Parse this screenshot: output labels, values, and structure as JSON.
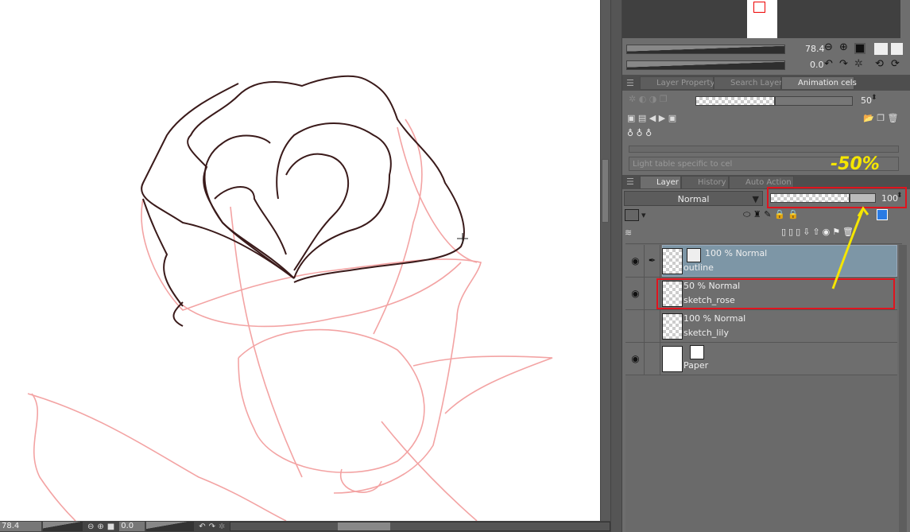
{
  "navigator": {
    "zoom": "78.4",
    "rotation": "0.0"
  },
  "tabs_top": [
    {
      "label": "Layer Property"
    },
    {
      "label": "Search Layer"
    },
    {
      "label": "Animation cels"
    }
  ],
  "animation_cels": {
    "opacity": "50",
    "light_table_label": "Light table specific to cel"
  },
  "tabs_layer": [
    {
      "label": "Layer"
    },
    {
      "label": "History"
    },
    {
      "label": "Auto Action"
    }
  ],
  "layer_panel": {
    "blend_mode": "Normal",
    "opacity": "100"
  },
  "layers": [
    {
      "opacity_mode": "100 % Normal",
      "name": "outline",
      "visible": true,
      "selected": true
    },
    {
      "opacity_mode": "50 % Normal",
      "name": "sketch_rose",
      "visible": true
    },
    {
      "opacity_mode": "100 % Normal",
      "name": "sketch_lily",
      "visible": false
    },
    {
      "opacity_mode": "",
      "name": "Paper",
      "visible": true
    }
  ],
  "annotation": {
    "text": "-50%",
    "color": "#f5e600",
    "highlight_color": "#e0141e"
  },
  "statusbar": {
    "zoom": "78.4",
    "rotation": "0.0"
  }
}
